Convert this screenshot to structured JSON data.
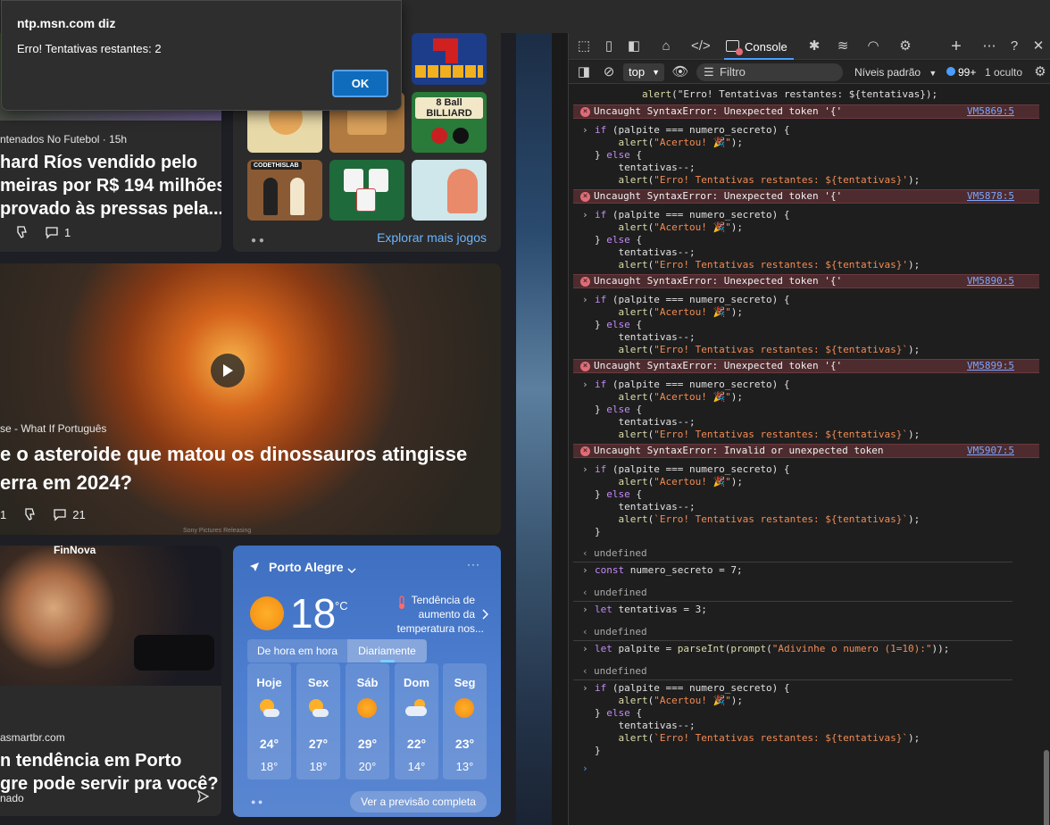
{
  "dialog": {
    "origin": "ntp.msn.com diz",
    "message": "Erro! Tentativas restantes: 2",
    "ok_label": "OK"
  },
  "news1": {
    "source": "ntenados No Futebol · 15h",
    "title_lines": [
      "hard Ríos vendido pelo",
      "meiras por R$ 194 milhões",
      "provado às pressas pela..."
    ],
    "comments": "1"
  },
  "games": {
    "explore_label": "Explorar mais jogos",
    "tile_labels": [
      "CODETHISLAB",
      "8 Ball BILLIARD"
    ]
  },
  "video": {
    "source": "se - What If Português",
    "title_lines": [
      "e o asteroide que matou os dinossauros atingisse",
      "erra em 2024?"
    ],
    "likes": "1",
    "comments": "21",
    "credit": "Sony Pictures Releasing"
  },
  "news2": {
    "logo": "FinNova",
    "source": "asmartbr.com",
    "title_lines": [
      "n tendência em Porto",
      "gre pode servir pra você?"
    ],
    "footer": "nado"
  },
  "weather": {
    "location": "Porto Alegre",
    "temperature": "18",
    "unit": "°C",
    "trend_lines": [
      "Tendência de",
      "aumento da",
      "temperatura nos..."
    ],
    "tab_hourly": "De hora em hora",
    "tab_daily": "Diariamente",
    "more_label": "Ver a previsão completa",
    "days": [
      {
        "name": "Hoje",
        "icon": "partly-sunny-icon",
        "high": "24°",
        "low": "18°"
      },
      {
        "name": "Sex",
        "icon": "partly-sunny-icon",
        "high": "27°",
        "low": "18°"
      },
      {
        "name": "Sáb",
        "icon": "sunny-icon",
        "high": "29°",
        "low": "20°"
      },
      {
        "name": "Dom",
        "icon": "cloudy-icon",
        "high": "22°",
        "low": "14°"
      },
      {
        "name": "Seg",
        "icon": "sunny-icon",
        "high": "23°",
        "low": "13°"
      }
    ]
  },
  "devtools": {
    "console_tab": "Console",
    "context": "top",
    "filter_placeholder": "Filtro",
    "levels": "Níveis padrão",
    "issues_count": "99+",
    "hidden": "1 oculto"
  },
  "console": {
    "top_line": "        alert(\"Erro! Tentativas restantes: ${tentativas});",
    "errors": [
      {
        "msg": "Uncaught SyntaxError: Unexpected token '{'",
        "link": "VM5869:5"
      },
      {
        "msg": "Uncaught SyntaxError: Unexpected token '{'",
        "link": "VM5878:5"
      },
      {
        "msg": "Uncaught SyntaxError: Unexpected token '{'",
        "link": "VM5890:5"
      },
      {
        "msg": "Uncaught SyntaxError: Unexpected token '{'",
        "link": "VM5899:5"
      },
      {
        "msg": "Uncaught SyntaxError: Invalid or unexpected token",
        "link": "VM5907:5"
      }
    ],
    "blocks": [
      [
        "if (palpite === numero_secreto) {",
        "    alert(\"Acertou! 🎉\");",
        "} else {",
        "    tentativas--;",
        "    alert(\"Erro! Tentativas restantes: ${tentativas}');"
      ],
      [
        "if (palpite === numero_secreto) {",
        "    alert(\"Acertou! 🎉\");",
        "} else {",
        "    tentativas--;",
        "    alert(\"Erro! Tentativas restantes: ${tentativas}');"
      ],
      [
        "if (palpite === numero_secreto) {",
        "    alert(\"Acertou! 🎉\");",
        "} else {",
        "    tentativas--;",
        "    alert(\"Erro! Tentativas restantes: ${tentativas}`);"
      ],
      [
        "if (palpite === numero_secreto) {",
        "    alert(\"Acertou! 🎉\");",
        "} else {",
        "    tentativas--;",
        "    alert(\"Erro! Tentativas restantes: ${tentativas}`);"
      ],
      [
        "if (palpite === numero_secreto) {",
        "    alert(\"Acertou! 🎉\");",
        "} else {",
        "    tentativas--;",
        "    alert(`Erro! Tentativas restantes: ${tentativas}`);",
        "}"
      ]
    ],
    "undefined_label": "undefined",
    "cmd1": "const numero_secreto = 7;",
    "cmd2": "let tentativas = 3;",
    "cmd3": "let palpite = parseInt(prompt(\"Adivinhe o numero (1=10):\"));",
    "final_block": [
      "if (palpite === numero_secreto) {",
      "    alert(\"Acertou! 🎉\");",
      "} else {",
      "    tentativas--;",
      "    alert(`Erro! Tentativas restantes: ${tentativas}`);",
      "}"
    ]
  }
}
